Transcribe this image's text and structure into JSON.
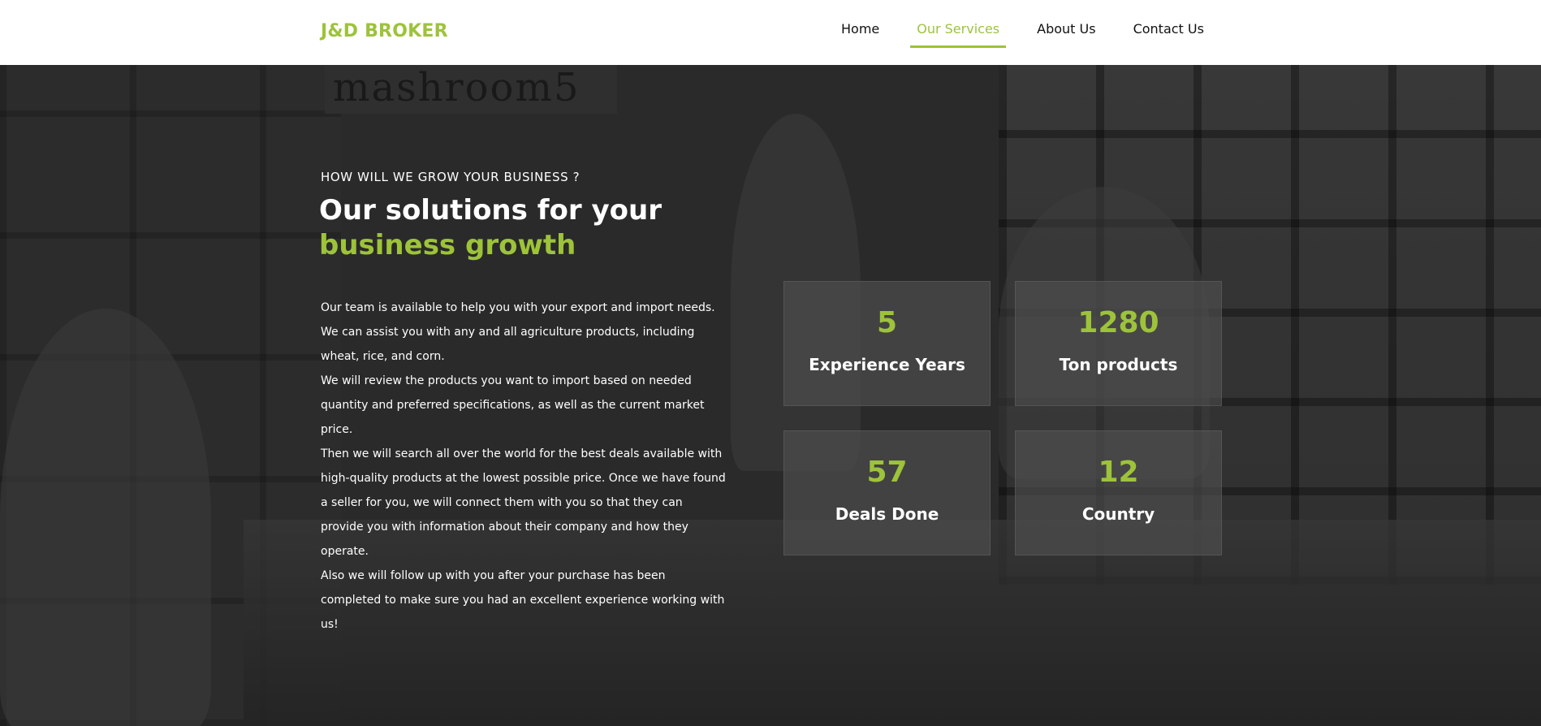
{
  "brand": {
    "name": "J&D BROKER",
    "accent": "#9dc33a"
  },
  "nav": {
    "items": [
      {
        "label": "Home",
        "active": false
      },
      {
        "label": "Our Services",
        "active": true
      },
      {
        "label": "About Us",
        "active": false
      },
      {
        "label": "Contact Us",
        "active": false
      }
    ]
  },
  "hero": {
    "background_sign_text": "mashroom5",
    "kicker": "HOW WILL WE GROW YOUR BUSINESS ?",
    "title_line1": "Our solutions for your",
    "title_line2": "business growth",
    "paragraphs": [
      "Our team is available to help you with your export and import needs. We can assist you with any and all agriculture products, including wheat, rice, and corn.",
      "We will review the products you want to import based on needed quantity and preferred specifications, as well as the current market price.",
      "Then we will search all over the world for the best deals available with high-quality products at the lowest possible price. Once we have found a seller for you, we will connect them with you so that they can provide you with information about their company and how they operate.",
      "Also we will follow up with you after your purchase has been completed to make sure you had an excellent experience working with us!"
    ]
  },
  "stats": [
    {
      "value": "5",
      "label": "Experience Years"
    },
    {
      "value": "1280",
      "label": "Ton products"
    },
    {
      "value": "57",
      "label": "Deals Done"
    },
    {
      "value": "12",
      "label": "Country"
    }
  ]
}
